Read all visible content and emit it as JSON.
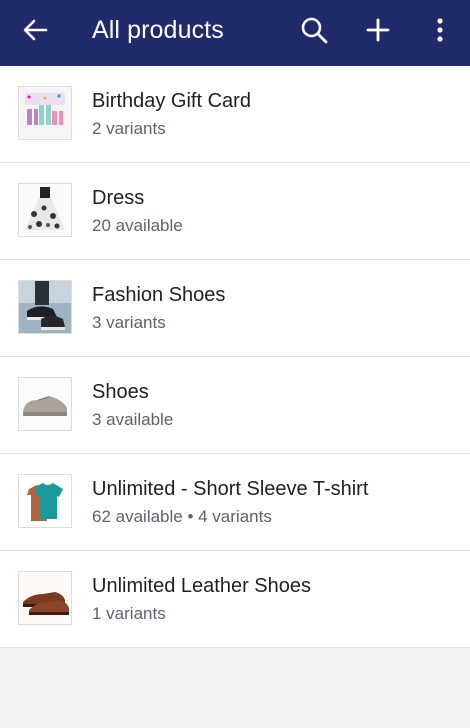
{
  "appbar": {
    "title": "All products",
    "back_icon": "arrow-back-icon",
    "search_icon": "search-icon",
    "add_icon": "plus-icon",
    "more_icon": "more-vert-icon",
    "background": "#212a6b"
  },
  "products": [
    {
      "name": "Birthday Gift Card",
      "detail": "2 variants",
      "thumb": "gift-card-image"
    },
    {
      "name": "Dress",
      "detail": "20 available",
      "thumb": "dress-image"
    },
    {
      "name": "Fashion Shoes",
      "detail": "3 variants",
      "thumb": "fashion-shoes-image"
    },
    {
      "name": "Shoes",
      "detail": "3 available",
      "thumb": "grey-shoe-image"
    },
    {
      "name": "Unlimited - Short Sleeve T-shirt",
      "detail": "62 available • 4 variants",
      "thumb": "tshirt-image"
    },
    {
      "name": "Unlimited Leather Shoes",
      "detail": "1 variants",
      "thumb": "leather-shoes-image"
    }
  ]
}
